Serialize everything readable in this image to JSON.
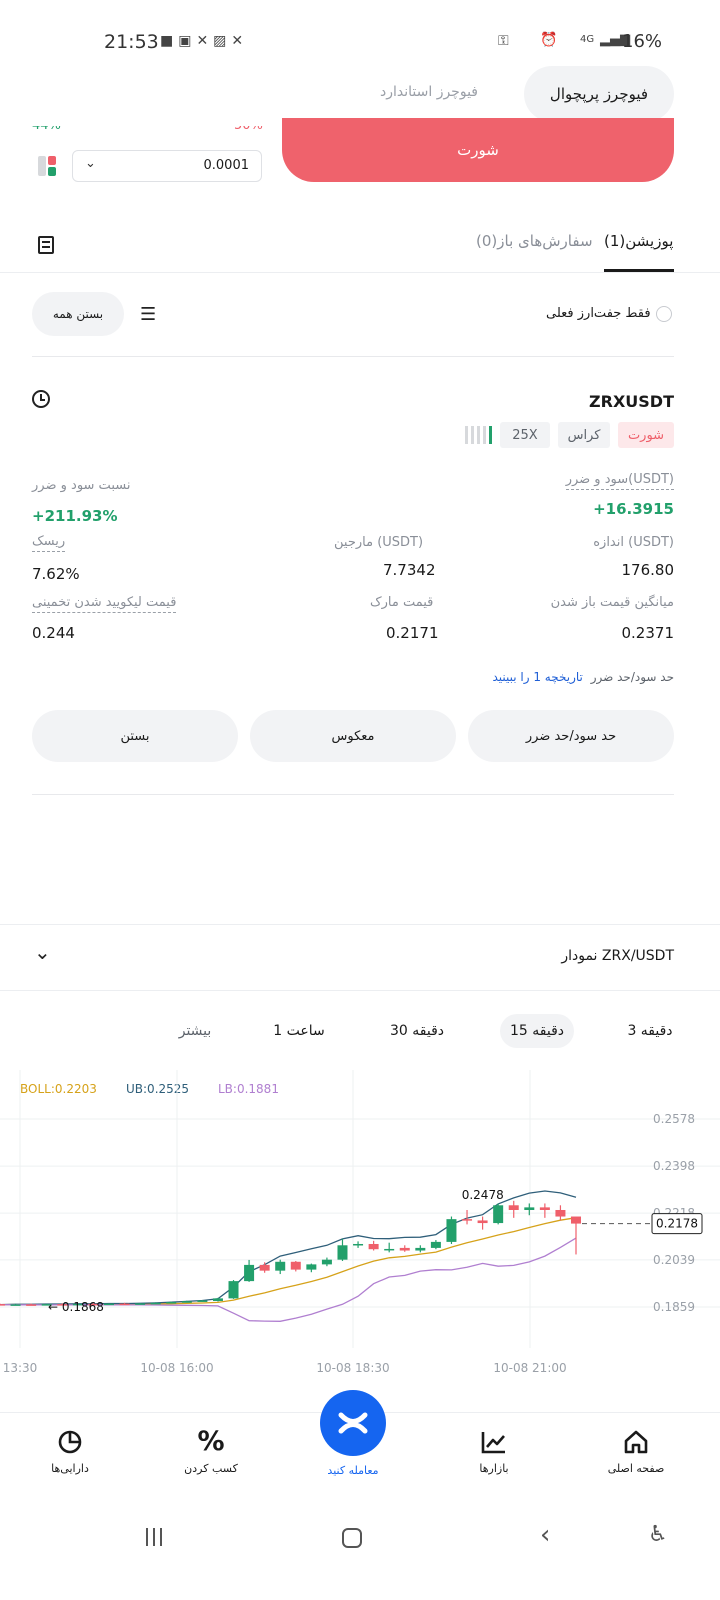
{
  "status_bar": {
    "time": "21:53",
    "battery": "16%",
    "network": "4G"
  },
  "tabs_top": {
    "active": "فیوچرز پرپچوال",
    "inactive": "فیوچرز استاندارد"
  },
  "order": {
    "partial_left": "44%",
    "partial_right": "50%",
    "quantity_value": "0.0001",
    "short_button": "شورت"
  },
  "position_tabs": {
    "positions": "پوزیشن(1)",
    "open_orders": "سفارش‌های باز(0)"
  },
  "filter": {
    "current_pair_only": "فقط جفت‌ارز فعلی",
    "close_all": "بستن همه"
  },
  "position": {
    "symbol": "ZRXUSDT",
    "side": "شورت",
    "margin_mode": "کراس",
    "leverage": "25X",
    "pnl_label": "سود و ضرر(USDT)",
    "pnl_value": "+16.3915",
    "pnl_ratio_label": "نسبت سود و ضرر",
    "pnl_ratio_value": "+211.93%",
    "size_label": "اندازه (USDT)",
    "size_value": "176.80",
    "margin_label": "مارجین (USDT)",
    "margin_value": "7.7342",
    "risk_label": "ریسک",
    "risk_value": "7.62%",
    "entry_label": "میانگین قیمت باز شدن",
    "entry_value": "0.2371",
    "mark_label": "قیمت مارک",
    "mark_value": "0.2171",
    "liq_label": "قیمت لیکویید شدن تخمینی",
    "liq_value": "0.244",
    "tpsl_text": "حد سود/حد ضرر",
    "tpsl_link": "تاریخچه 1 را ببینید",
    "btn_tpsl": "حد سود/حد ضرر",
    "btn_reverse": "معکوس",
    "btn_close": "بستن"
  },
  "chart_section": {
    "title": "نمودار ZRX/USDT",
    "timeframes": [
      "3 دقیقه",
      "15 دقیقه",
      "30 دقیقه",
      "1 ساعت",
      "بیشتر"
    ],
    "active_timeframe": "15 دقیقه",
    "boll": "BOLL:0.2203",
    "ub": "UB:0.2525",
    "lb": "LB:0.1881",
    "colors": {
      "up": "#22a06b",
      "down": "#ef5f6a",
      "mid": "#d6a21a",
      "ub": "#2f5f7a",
      "lb": "#b07fd0"
    }
  },
  "chart_data": {
    "type": "candlestick",
    "x_tick_labels": [
      "13:30",
      "10-08 16:00",
      "10-08 18:30",
      "10-08 21:00"
    ],
    "y_tick_labels": [
      "0.2578",
      "0.2398",
      "0.2218",
      "0.2039",
      "0.1859"
    ],
    "ylim": [
      0.1859,
      0.2578
    ],
    "current_price": "0.2178",
    "max_label": "0.2478",
    "min_label": "0.1868",
    "candles": [
      {
        "o": 0.187,
        "h": 0.1872,
        "l": 0.1866,
        "c": 0.1868
      },
      {
        "o": 0.1868,
        "h": 0.1871,
        "l": 0.1866,
        "c": 0.1869
      },
      {
        "o": 0.1869,
        "h": 0.1872,
        "l": 0.1867,
        "c": 0.1868
      },
      {
        "o": 0.1868,
        "h": 0.1871,
        "l": 0.1866,
        "c": 0.187
      },
      {
        "o": 0.187,
        "h": 0.1873,
        "l": 0.1868,
        "c": 0.1869
      },
      {
        "o": 0.1869,
        "h": 0.1872,
        "l": 0.1867,
        "c": 0.1871
      },
      {
        "o": 0.1871,
        "h": 0.1874,
        "l": 0.1869,
        "c": 0.187
      },
      {
        "o": 0.187,
        "h": 0.1873,
        "l": 0.1868,
        "c": 0.1872
      },
      {
        "o": 0.1872,
        "h": 0.1875,
        "l": 0.187,
        "c": 0.1871
      },
      {
        "o": 0.1871,
        "h": 0.1874,
        "l": 0.1869,
        "c": 0.1873
      },
      {
        "o": 0.1873,
        "h": 0.1877,
        "l": 0.1871,
        "c": 0.1875
      },
      {
        "o": 0.1875,
        "h": 0.188,
        "l": 0.1873,
        "c": 0.1878
      },
      {
        "o": 0.1878,
        "h": 0.1883,
        "l": 0.1876,
        "c": 0.1881
      },
      {
        "o": 0.1881,
        "h": 0.1886,
        "l": 0.1879,
        "c": 0.1884
      },
      {
        "o": 0.1882,
        "h": 0.1894,
        "l": 0.188,
        "c": 0.1892
      },
      {
        "o": 0.1892,
        "h": 0.1962,
        "l": 0.189,
        "c": 0.1958
      },
      {
        "o": 0.1958,
        "h": 0.2039,
        "l": 0.1955,
        "c": 0.202
      },
      {
        "o": 0.202,
        "h": 0.203,
        "l": 0.199,
        "c": 0.1998
      },
      {
        "o": 0.1998,
        "h": 0.204,
        "l": 0.1985,
        "c": 0.2032
      },
      {
        "o": 0.2032,
        "h": 0.2035,
        "l": 0.1995,
        "c": 0.2002
      },
      {
        "o": 0.2002,
        "h": 0.2025,
        "l": 0.1992,
        "c": 0.2022
      },
      {
        "o": 0.2022,
        "h": 0.2048,
        "l": 0.2015,
        "c": 0.204
      },
      {
        "o": 0.204,
        "h": 0.212,
        "l": 0.2035,
        "c": 0.2095
      },
      {
        "o": 0.2095,
        "h": 0.211,
        "l": 0.2085,
        "c": 0.21
      },
      {
        "o": 0.21,
        "h": 0.2112,
        "l": 0.2075,
        "c": 0.208
      },
      {
        "o": 0.208,
        "h": 0.2105,
        "l": 0.2068,
        "c": 0.2081
      },
      {
        "o": 0.2085,
        "h": 0.2095,
        "l": 0.207,
        "c": 0.2075
      },
      {
        "o": 0.2075,
        "h": 0.2095,
        "l": 0.2068,
        "c": 0.2085
      },
      {
        "o": 0.2085,
        "h": 0.2115,
        "l": 0.208,
        "c": 0.2108
      },
      {
        "o": 0.2108,
        "h": 0.2205,
        "l": 0.21,
        "c": 0.2195
      },
      {
        "o": 0.2195,
        "h": 0.223,
        "l": 0.2175,
        "c": 0.219
      },
      {
        "o": 0.219,
        "h": 0.2205,
        "l": 0.2155,
        "c": 0.218
      },
      {
        "o": 0.218,
        "h": 0.2255,
        "l": 0.2175,
        "c": 0.2248
      },
      {
        "o": 0.2248,
        "h": 0.2265,
        "l": 0.22,
        "c": 0.223
      },
      {
        "o": 0.223,
        "h": 0.2255,
        "l": 0.221,
        "c": 0.224
      },
      {
        "o": 0.224,
        "h": 0.2255,
        "l": 0.22,
        "c": 0.223
      },
      {
        "o": 0.223,
        "h": 0.2248,
        "l": 0.219,
        "c": 0.2205
      },
      {
        "o": 0.2205,
        "h": 0.218,
        "l": 0.206,
        "c": 0.2178
      }
    ]
  },
  "bottom_nav": {
    "home": "صفحه اصلی",
    "markets": "بازارها",
    "trade": "معامله کنید",
    "earn": "کسب کردن",
    "assets": "دارایی‌ها"
  }
}
